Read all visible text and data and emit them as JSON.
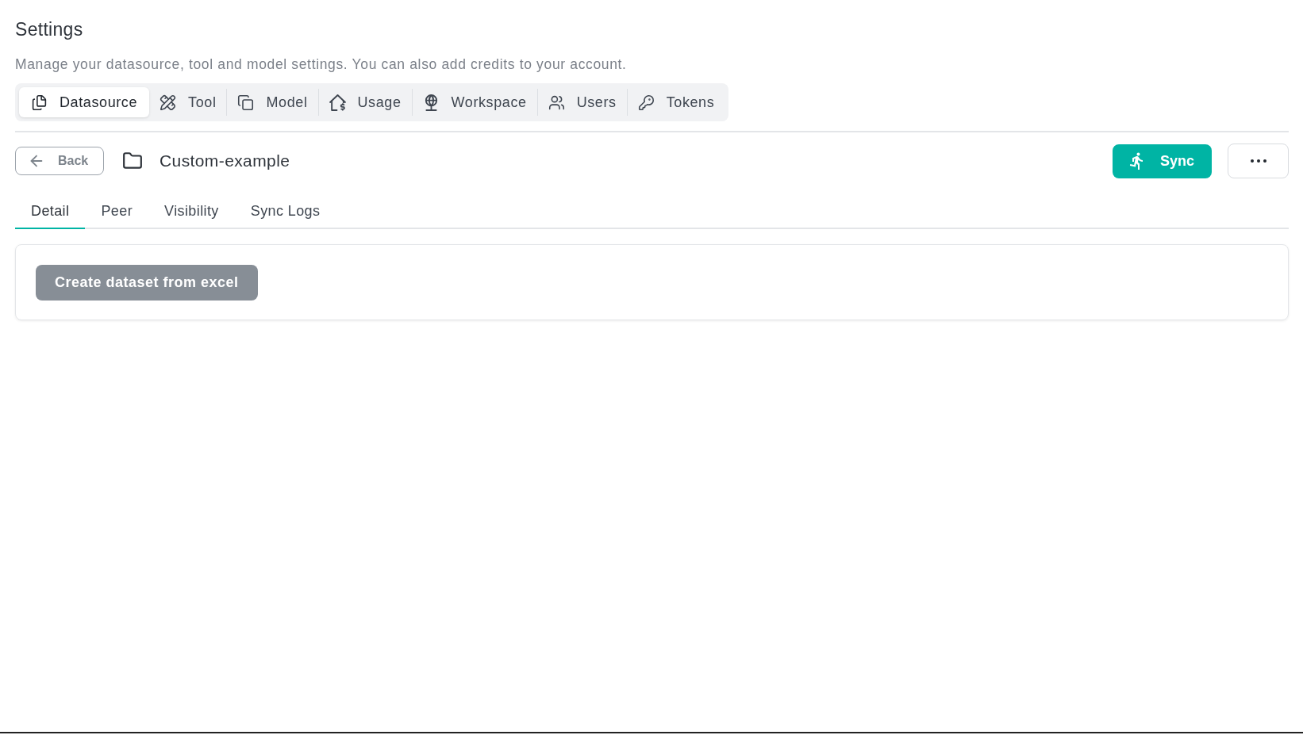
{
  "page": {
    "title": "Settings",
    "description": "Manage your datasource, tool and model settings. You can also add credits to your account."
  },
  "settings_tabs": [
    {
      "label": "Datasource",
      "selected": true
    },
    {
      "label": "Tool",
      "selected": false
    },
    {
      "label": "Model",
      "selected": false
    },
    {
      "label": "Usage",
      "selected": false
    },
    {
      "label": "Workspace",
      "selected": false
    },
    {
      "label": "Users",
      "selected": false
    },
    {
      "label": "Tokens",
      "selected": false
    }
  ],
  "header": {
    "back_button": "Back",
    "title": "Custom-example",
    "sync_button": "Sync"
  },
  "detail_tabs": [
    {
      "label": "Detail",
      "selected": true
    },
    {
      "label": "Peer",
      "selected": false
    },
    {
      "label": "Visibility",
      "selected": false
    },
    {
      "label": "Sync Logs",
      "selected": false
    }
  ],
  "card": {
    "button": "Create dataset from excel"
  }
}
